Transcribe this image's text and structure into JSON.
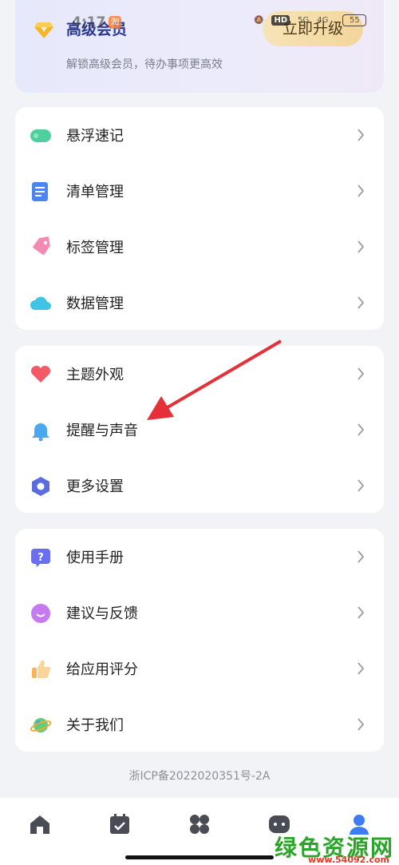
{
  "status_bar": {
    "time": "4:17",
    "app_badge": "淘",
    "hd": "HD",
    "net1": "5G",
    "net2": "4G",
    "battery": "55"
  },
  "premium": {
    "title": "高级会员",
    "subtitle": "解锁高级会员，待办事项更高效",
    "upgrade_label": "立即升级"
  },
  "group1": [
    {
      "label": "悬浮速记",
      "icon": "floating-note-icon"
    },
    {
      "label": "清单管理",
      "icon": "checklist-icon"
    },
    {
      "label": "标签管理",
      "icon": "tag-icon"
    },
    {
      "label": "数据管理",
      "icon": "cloud-icon"
    }
  ],
  "group2": [
    {
      "label": "主题外观",
      "icon": "heart-icon"
    },
    {
      "label": "提醒与声音",
      "icon": "bell-icon"
    },
    {
      "label": "更多设置",
      "icon": "hexagon-settings-icon"
    }
  ],
  "group3": [
    {
      "label": "使用手册",
      "icon": "help-icon"
    },
    {
      "label": "建议与反馈",
      "icon": "feedback-icon"
    },
    {
      "label": "给应用评分",
      "icon": "thumbs-up-icon"
    },
    {
      "label": "关于我们",
      "icon": "planet-icon"
    }
  ],
  "footer": {
    "icp": "浙ICP备2022020351号-2A"
  },
  "tabbar": [
    {
      "name": "home-tab",
      "icon": "home-icon"
    },
    {
      "name": "calendar-tab",
      "icon": "calendar-icon"
    },
    {
      "name": "apps-tab",
      "icon": "grid-icon"
    },
    {
      "name": "chat-tab",
      "icon": "chat-icon"
    },
    {
      "name": "profile-tab",
      "icon": "profile-icon"
    }
  ],
  "watermark": {
    "text": "绿色资源网",
    "url": "www.54092.com"
  },
  "colors": {
    "accent": "#2b3a8f",
    "arrow": "#e5303a",
    "upgrade": "#f3d59a",
    "profile_active": "#3d7cf2"
  }
}
